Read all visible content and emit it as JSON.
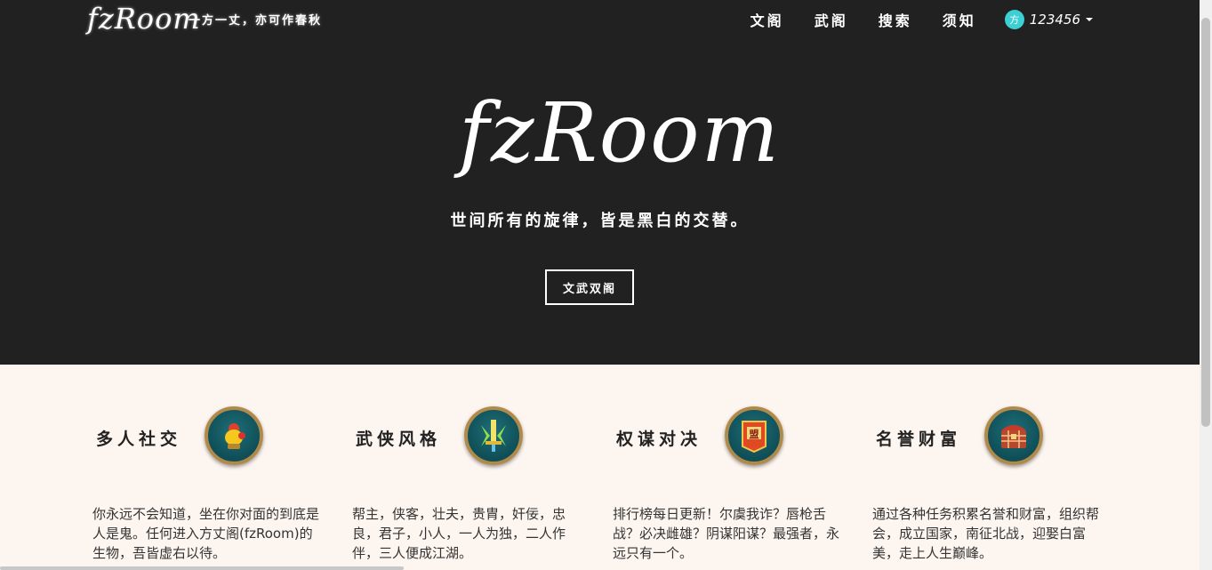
{
  "header": {
    "logo": "fzRoom",
    "slogan": "一方一丈，亦可作春秋",
    "nav": [
      "文阁",
      "武阁",
      "搜索",
      "须知"
    ],
    "user": {
      "avatar_glyph": "方",
      "name": "123456"
    }
  },
  "hero": {
    "logo": "fzRoom",
    "motto": "世间所有的旋律，皆是黑白的交替。",
    "button": "文武双阁"
  },
  "features": [
    {
      "title": "多人社交",
      "icon": "character-icon",
      "desc": "你永远不会知道，坐在你对面的到底是人是鬼。任何进入方丈阁(fzRoom)的生物，吾皆虚右以待。"
    },
    {
      "title": "武侠风格",
      "icon": "sword-icon",
      "desc": "帮主，侠客，壮夫，贵胄，奸佞，忠良，君子，小人，一人为独，二人作伴，三人便成江湖。"
    },
    {
      "title": "权谋对决",
      "icon": "banner-icon",
      "icon_text": "盟",
      "desc": "排行榜每日更新！尔虞我诈？唇枪舌战？必决雌雄？阴谋阳谋？最强者，永远只有一个。"
    },
    {
      "title": "名誉财富",
      "icon": "treasure-chest-icon",
      "desc": "通过各种任务积累名誉和财富，组织帮会，成立国家，南征北战，迎娶白富美，走上人生巅峰。"
    }
  ],
  "colors": {
    "hero_bg": "#212121",
    "page_bg": "#fdf5ef",
    "avatar": "#3ccfd3",
    "icon_ring": "#b08a4a"
  }
}
